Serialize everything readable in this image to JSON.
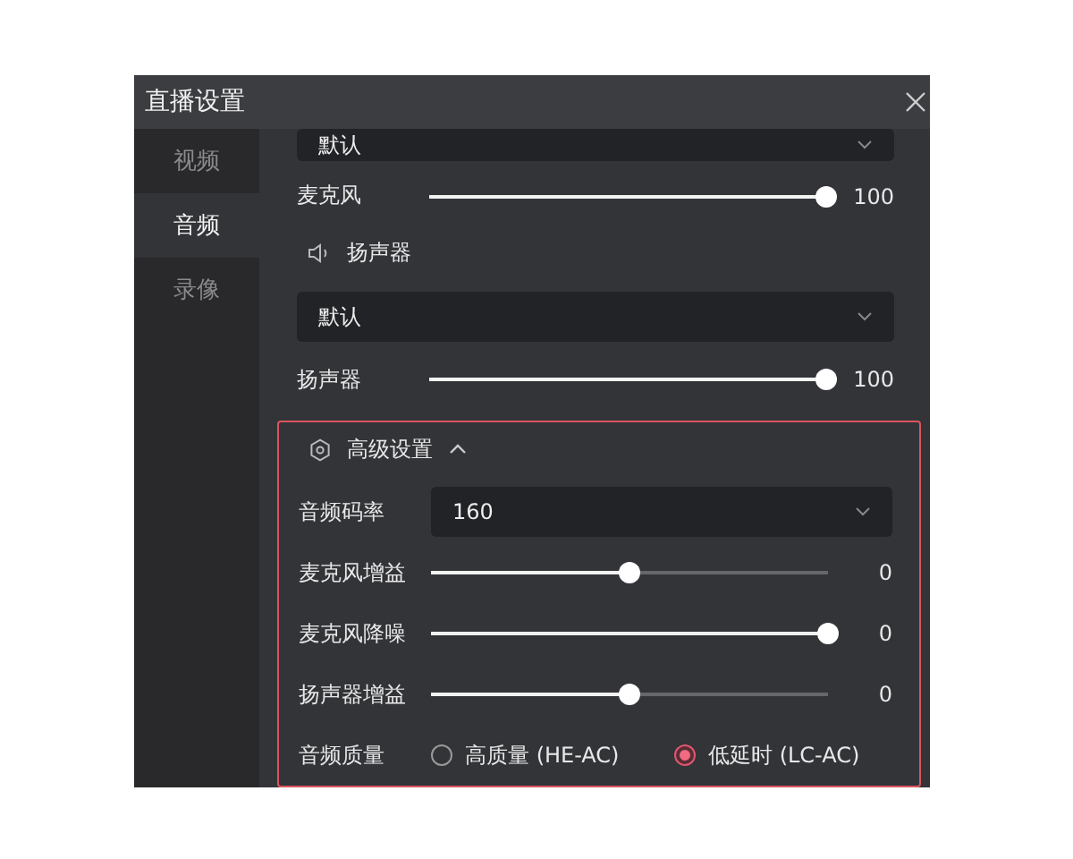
{
  "window": {
    "title": "直播设置"
  },
  "sidebar": {
    "items": [
      {
        "label": "视频",
        "selected": false
      },
      {
        "label": "音频",
        "selected": true
      },
      {
        "label": "录像",
        "selected": false
      }
    ]
  },
  "mic_device": {
    "value": "默认"
  },
  "mic_volume": {
    "label": "麦克风",
    "level": 1,
    "reading": "100"
  },
  "speaker_heading": {
    "title": "扬声器"
  },
  "speaker_device": {
    "value": "默认"
  },
  "speaker_volume": {
    "label": "扬声器",
    "level": 1,
    "reading": "100"
  },
  "advanced": {
    "title": "高级设置",
    "expanded": true,
    "highlighted": true,
    "bitrate": {
      "label": "音频码率",
      "value": "160"
    },
    "sliders": [
      {
        "label": "麦克风增益",
        "level": 0.5,
        "reading": "0"
      },
      {
        "label": "麦克风降噪",
        "level": 1,
        "reading": "0"
      },
      {
        "label": "扬声器增益",
        "level": 0.5,
        "reading": "0"
      }
    ],
    "quality": {
      "label": "音频质量",
      "options": [
        {
          "label": "高质量 (HE-AC)",
          "selected": false
        },
        {
          "label": "低延时 (LC-AC)",
          "selected": true
        }
      ]
    }
  }
}
